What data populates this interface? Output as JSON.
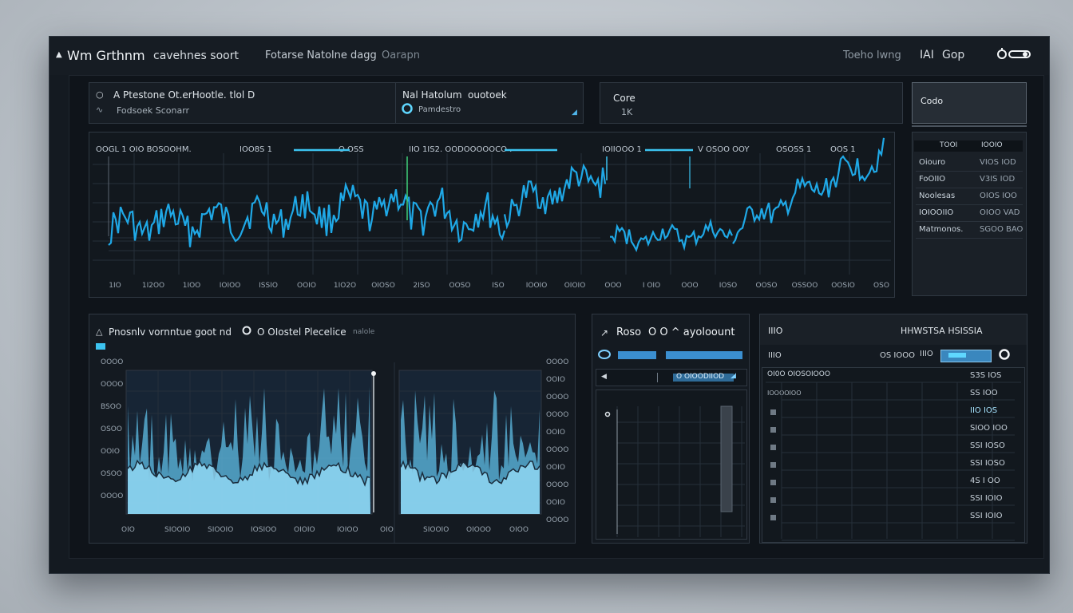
{
  "app": {
    "title": "Wm Grthnm",
    "subtitle": "cavehnes soort",
    "nav": "Fotarse Natolne dagg",
    "nav_extra": "Oarapn",
    "right_label": "Toeho lwng",
    "right_short": "IAI",
    "right_group": "Gop",
    "arrow_icon": "triangle-up-icon",
    "toggle_icon": "power-toggle-icon"
  },
  "header_cards": {
    "card1": {
      "line1": "A Ptestone Ot.erHootle. tlol D",
      "line2": "Fodsoek Sconarr"
    },
    "card2": {
      "line1": "Nal Hatolum",
      "line1b": "ouotoek",
      "line2": "Pamdestro"
    },
    "card3": {
      "line1": "Core",
      "line2": "1K"
    },
    "card4": {
      "label": "Codo"
    }
  },
  "main_chart": {
    "labels": [
      "OOGL 1 OIO BOSOOHM.",
      "IOO8S 1",
      "O OSS",
      "IIO 1IS2. OODOOOOOCO .",
      "IOIIOOO 1",
      "V OSOO OOY",
      "OSOSS 1",
      "OOS 1"
    ],
    "x_ticks": [
      "1IO",
      "1I2OO",
      "1IOO",
      "IOIOO",
      "ISSIO",
      "OOIO",
      "1IO2O",
      "OIOSO",
      "2ISO",
      "OOSO",
      "ISO",
      "IOOIO",
      "OIOIO",
      "OOO",
      "I OIO",
      "OOO",
      "IOSO",
      "OOSO",
      "OSSOO",
      "OOSIO",
      "OSO"
    ]
  },
  "watchlist": {
    "header_left": "TOOI",
    "header_right": "IOOIO",
    "rows": [
      {
        "label": "Oiouro",
        "value": "VIOS IOD"
      },
      {
        "label": "FoOIIO",
        "value": "V3IS IOD"
      },
      {
        "label": "Noolesas",
        "value": "OIOS IOO"
      },
      {
        "label": "IOIOOIIO",
        "value": "OIOO VAD"
      },
      {
        "label": "Matmonos.",
        "value": "SGOO BAO"
      }
    ]
  },
  "volume_panel": {
    "title": "Pnosnlv vornntue goot nd",
    "title_b": "O OIostel Plecelice",
    "note": "nalole",
    "y_ticks": [
      "OOOO",
      "OOOO",
      "BSOO",
      "OSOO",
      "OOIO",
      "OSOO",
      "OOOO"
    ],
    "right_ticks": [
      "OOOO",
      "OOIO",
      "OOOO",
      "OOOO",
      "OOIO",
      "OOOO",
      "OOIO",
      "OOOO",
      "OOIO",
      "OOOO"
    ],
    "x_ticks": [
      "OIO",
      "SIOOIO",
      "SIOOIO",
      "IOSIOO",
      "OIOIO",
      "IOIOO",
      "OIO",
      "SIOOIO",
      "OIOOO",
      "OIOO"
    ]
  },
  "order_panel": {
    "title": "Roso",
    "title_b": "O O ^ ayoloount",
    "input_label": "O OIOODIIOD"
  },
  "trade_panel": {
    "header_left": "IIIO",
    "header_right": "HHWSTSA HSISSIA",
    "sub_left": "IIIO",
    "sub_mid": "OS IOOO",
    "sub_small": "IIIO",
    "col_header": "OI0O OIOSOIOOO",
    "col_header2": "IOOOOIOO",
    "values": [
      "S3S IOS",
      "SS IOO",
      "IIO IOS",
      "SIOO IOO",
      "SSI IOSO",
      "SSI IOSO",
      "4S I OO",
      "SSI IOIO",
      "SSI IOIO"
    ]
  },
  "colors": {
    "accent": "#3cc3f0",
    "line": "#1fa8e6",
    "panel": "#141a21",
    "green": "#3fd17a"
  }
}
